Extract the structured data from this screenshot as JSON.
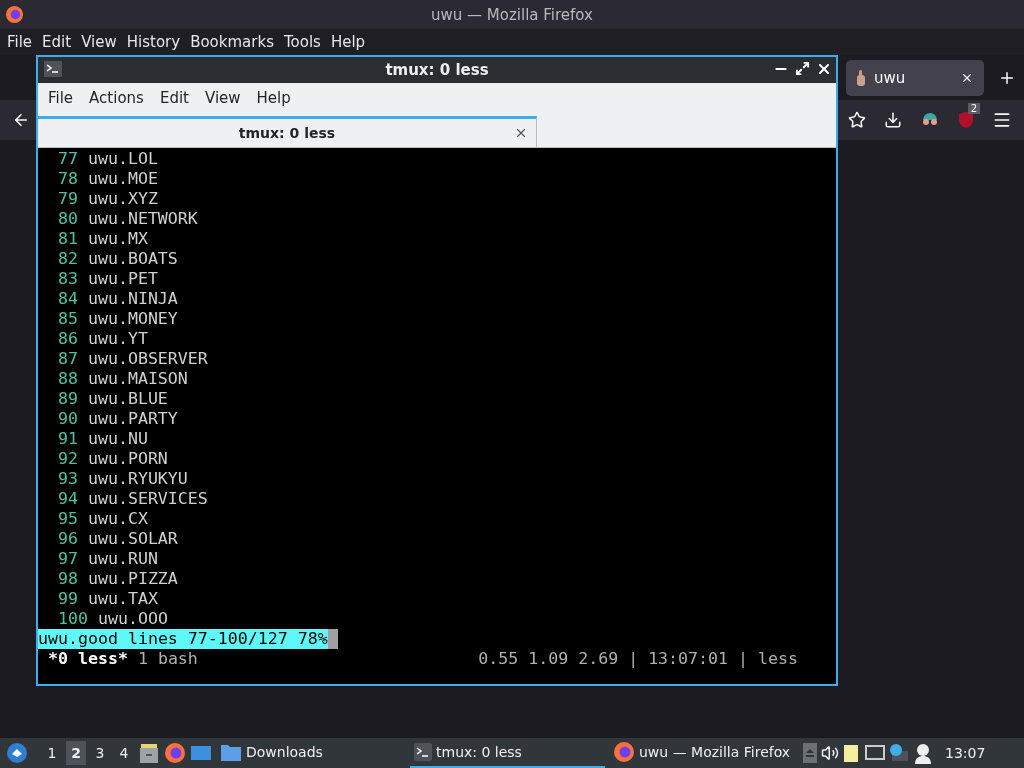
{
  "firefox": {
    "title": "uwu — Mozilla Firefox",
    "menu": [
      "File",
      "Edit",
      "View",
      "History",
      "Bookmarks",
      "Tools",
      "Help"
    ],
    "tabs": [
      {
        "label": "uwu",
        "selected": true
      }
    ],
    "badge": "2"
  },
  "terminal": {
    "title": "tmux: 0 less",
    "menu": [
      "File",
      "Actions",
      "Edit",
      "View",
      "Help"
    ],
    "tabs": [
      {
        "label": "tmux: 0 less",
        "selected": true
      }
    ],
    "lines": [
      {
        "number": "77",
        "text": "uwu.LOL"
      },
      {
        "number": "78",
        "text": "uwu.MOE"
      },
      {
        "number": "79",
        "text": "uwu.XYZ"
      },
      {
        "number": "80",
        "text": "uwu.NETWORK"
      },
      {
        "number": "81",
        "text": "uwu.MX"
      },
      {
        "number": "82",
        "text": "uwu.BOATS"
      },
      {
        "number": "83",
        "text": "uwu.PET"
      },
      {
        "number": "84",
        "text": "uwu.NINJA"
      },
      {
        "number": "85",
        "text": "uwu.MONEY"
      },
      {
        "number": "86",
        "text": "uwu.YT"
      },
      {
        "number": "87",
        "text": "uwu.OBSERVER"
      },
      {
        "number": "88",
        "text": "uwu.MAISON"
      },
      {
        "number": "89",
        "text": "uwu.BLUE"
      },
      {
        "number": "90",
        "text": "uwu.PARTY"
      },
      {
        "number": "91",
        "text": "uwu.NU"
      },
      {
        "number": "92",
        "text": "uwu.PORN"
      },
      {
        "number": "93",
        "text": "uwu.RYUKYU"
      },
      {
        "number": "94",
        "text": "uwu.SERVICES"
      },
      {
        "number": "95",
        "text": "uwu.CX"
      },
      {
        "number": "96",
        "text": "uwu.SOLAR"
      },
      {
        "number": "97",
        "text": "uwu.RUN"
      },
      {
        "number": "98",
        "text": "uwu.PIZZA"
      },
      {
        "number": "99",
        "text": "uwu.TAX"
      },
      {
        "number": "100",
        "text": "uwu.OOO"
      }
    ],
    "less_status": "uwu.good lines 77-100/127 78%",
    "tmux_windows": [
      {
        "label": "*0 less*",
        "selected": true
      },
      {
        "label": "1 bash",
        "selected": false
      }
    ],
    "tmux_right": "0.55 1.09 2.69 | 13:07:01 | less"
  },
  "taskbar": {
    "desktops": [
      {
        "label": "1",
        "selected": false
      },
      {
        "label": "2",
        "selected": true
      },
      {
        "label": "3",
        "selected": false
      },
      {
        "label": "4",
        "selected": false
      }
    ],
    "tasks": [
      {
        "kind": "folder",
        "label": "Downloads",
        "selected": false
      },
      {
        "kind": "terminal",
        "label": "tmux: 0 less",
        "selected": true
      },
      {
        "kind": "firefox",
        "label": "uwu — Mozilla Firefox",
        "selected": false
      }
    ],
    "clock": "13:07"
  }
}
